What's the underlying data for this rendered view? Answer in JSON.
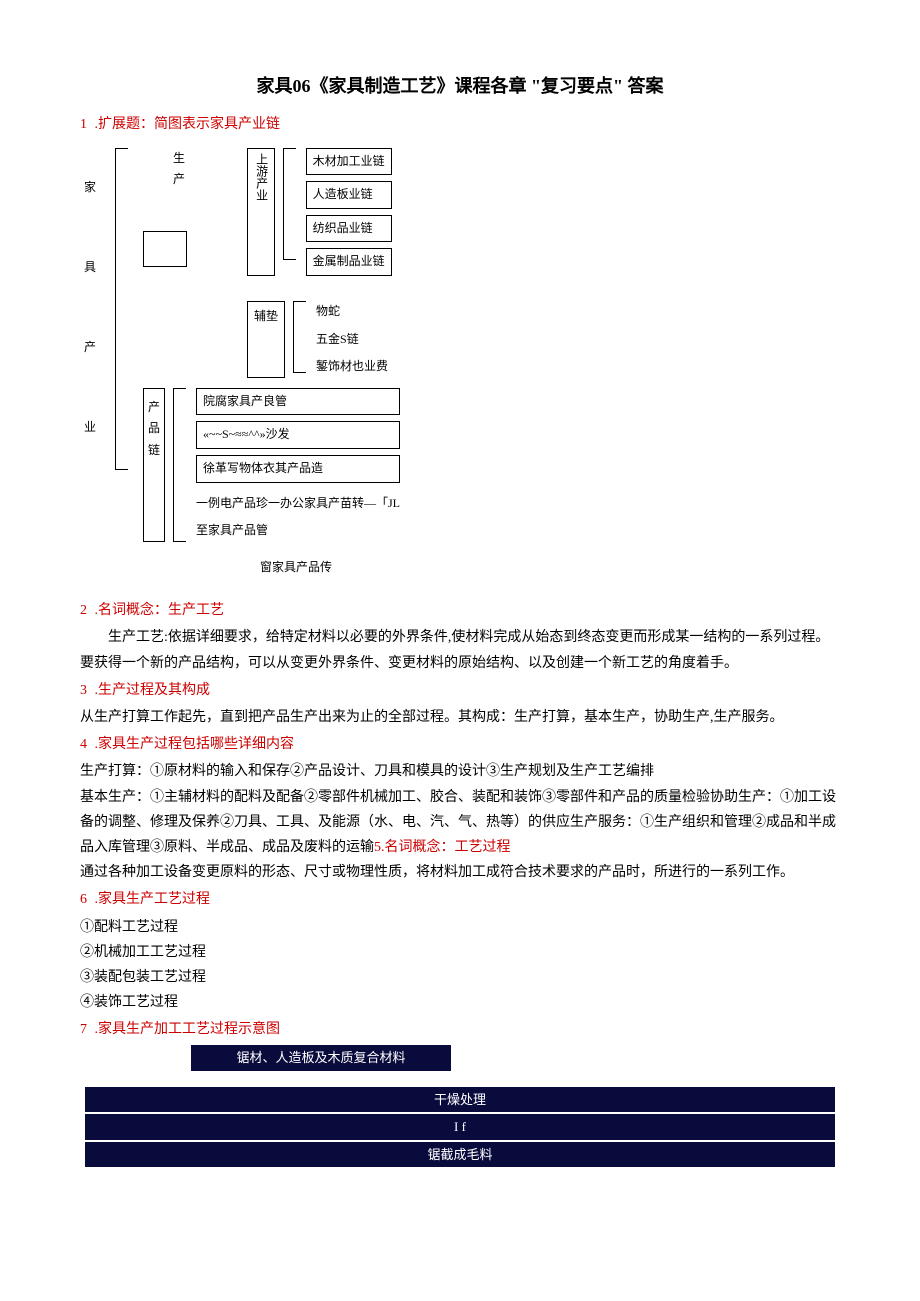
{
  "title": "家具06《家具制造工艺》课程各章 \"复习要点\" 答案",
  "q1": {
    "num": "1",
    "label": ".扩展题：简图表示家具产业链"
  },
  "diagram": {
    "furniture_industry": [
      "家",
      "具",
      "产",
      "业"
    ],
    "prod_chain_v": [
      "生",
      "产"
    ],
    "upstream_v": "上游产业",
    "upstream": [
      "木材加工业链",
      "人造板业链",
      "纺织品业链",
      "金属制品业链"
    ],
    "aux_v": "辅垫",
    "aux": [
      "物蛇",
      "五金S链",
      "錾饰材也业费"
    ],
    "product_chain_v": [
      "产",
      "品",
      "链"
    ],
    "prod_lines": [
      "院腐家具产良管",
      "«~~S~≈≈^^»沙发",
      "徐革写物体衣其产品造"
    ],
    "misc1": "一例电产品珍一办公家具产苗转—「JL",
    "misc2": "至家具产品管",
    "caption": "窗家具产品传"
  },
  "q2": {
    "num": "2",
    "label": ".名词概念：生产工艺"
  },
  "p2a": "生产工艺:依据详细要求，给特定材料以必要的外界条件,使材料完成从始态到终态变更而形成某一结构的一系列过程。",
  "p2b": "要获得一个新的产品结构，可以从变更外界条件、变更材料的原始结构、以及创建一个新工艺的角度着手。",
  "q3": {
    "num": "3",
    "label": ".生产过程及其构成"
  },
  "p3": "从生产打算工作起先，直到把产品生产出来为止的全部过程。其构成：生产打算，基本生产，协助生产,生产服务。",
  "q4": {
    "num": "4",
    "label": ".家具生产过程包括哪些详细内容"
  },
  "p4a": "生产打算：①原材料的输入和保存②产品设计、刀具和模具的设计③生产规划及生产工艺编排",
  "p4b_prefix": "基本生产：①主辅材料的配料及配备②零部件机械加工、胶合、装配和装饰③零部件和产品的质量检验协助生产：①加工设备的调整、修理及保养②刀具、工具、及能源（水、电、汽、气、热等）的供应生产服务：①生产组织和管理②成品和半成品入库管理③原料、半成品、成品及废料的运输",
  "q5_inline": "5.名词概念：工艺过程",
  "p5": "通过各种加工设备变更原料的形态、尺寸或物理性质，将材料加工成符合技术要求的产品时，所进行的一系列工作。",
  "q6": {
    "num": "6",
    "label": ".家具生产工艺过程"
  },
  "list6": [
    "①配料工艺过程",
    "②机械加工工艺过程",
    "③装配包装工艺过程",
    "④装饰工艺过程"
  ],
  "q7": {
    "num": "7",
    "label": ".家具生产加工工艺过程示意图"
  },
  "flow": [
    "锯材、人造板及木质复合材料",
    "干燥处理",
    "I f",
    "锯截成毛料"
  ]
}
